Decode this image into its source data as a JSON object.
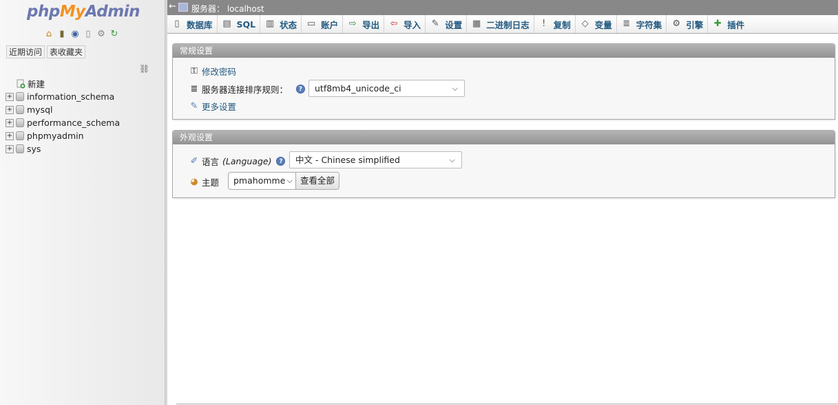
{
  "nav": {
    "logo": {
      "php": "php",
      "my": "My",
      "admin": "Admin"
    },
    "icons": [
      "home-icon",
      "logout-icon",
      "help-icon",
      "docs-icon",
      "settings-gear-icon",
      "reload-icon"
    ],
    "tabs": {
      "recent": "近期访问",
      "favorites": "表收藏夹"
    },
    "link_icon": "chain-link-icon",
    "new_label": "新建",
    "databases": [
      "information_schema",
      "mysql",
      "performance_schema",
      "phpmyadmin",
      "sys"
    ]
  },
  "topbar": {
    "back_arrow": "←",
    "breadcrumb": "服务器：  localhost"
  },
  "menu": [
    {
      "label": "数据库",
      "icon": "database-icon"
    },
    {
      "label": "SQL",
      "icon": "sql-icon"
    },
    {
      "label": "状态",
      "icon": "status-icon"
    },
    {
      "label": "账户",
      "icon": "accounts-icon"
    },
    {
      "label": "导出",
      "icon": "export-icon"
    },
    {
      "label": "导入",
      "icon": "import-icon"
    },
    {
      "label": "设置",
      "icon": "wrench-icon"
    },
    {
      "label": "二进制日志",
      "icon": "binlog-icon"
    },
    {
      "label": "复制",
      "icon": "replication-icon"
    },
    {
      "label": "变量",
      "icon": "variables-icon"
    },
    {
      "label": "字符集",
      "icon": "charset-icon"
    },
    {
      "label": "引擎",
      "icon": "engine-icon"
    },
    {
      "label": "插件",
      "icon": "plugin-icon"
    }
  ],
  "general": {
    "title": "常规设置",
    "change_password": "修改密码",
    "collation_label": "服务器连接排序规则：",
    "collation_value": "utf8mb4_unicode_ci",
    "more_settings": "更多设置"
  },
  "appearance": {
    "title": "外观设置",
    "language_label": "语言",
    "language_en": "(Language)",
    "language_value": "中文 - Chinese simplified",
    "theme_label": "主题",
    "theme_value": "pmahomme",
    "view_all": "查看全部"
  },
  "colors": {
    "link": "#235a81",
    "logo_blue": "#6c78af",
    "logo_orange": "#f49220",
    "topbar": "#888888"
  }
}
